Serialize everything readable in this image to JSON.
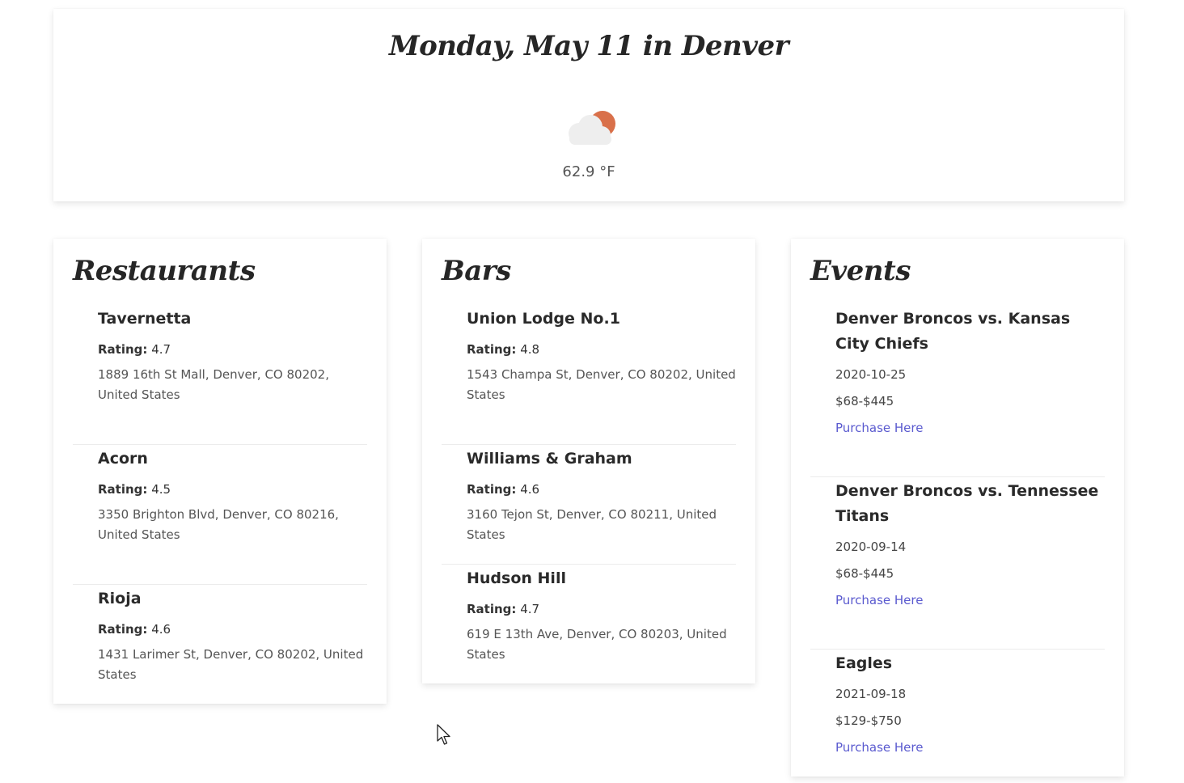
{
  "header": {
    "title": "Monday, May 11 in Denver",
    "weather_icon": "partly-cloudy-icon",
    "temperature": "62.9 °F"
  },
  "colors": {
    "sun": "#d9704a",
    "cloud": "#eeeeee",
    "link": "#5a5acf"
  },
  "restaurants": {
    "title": "Restaurants",
    "rating_label": "Rating:",
    "items": [
      {
        "name": "Tavernetta",
        "rating": "4.7",
        "address": "1889 16th St Mall, Denver, CO 80202, United States"
      },
      {
        "name": "Acorn",
        "rating": "4.5",
        "address": "3350 Brighton Blvd, Denver, CO 80216, United States"
      },
      {
        "name": "Rioja",
        "rating": "4.6",
        "address": "1431 Larimer St, Denver, CO 80202, United States"
      }
    ]
  },
  "bars": {
    "title": "Bars",
    "rating_label": "Rating:",
    "items": [
      {
        "name": "Union Lodge No.1",
        "rating": "4.8",
        "address": "1543 Champa St, Denver, CO 80202, United States"
      },
      {
        "name": "Williams & Graham",
        "rating": "4.6",
        "address": "3160 Tejon St, Denver, CO 80211, United States"
      },
      {
        "name": "Hudson Hill",
        "rating": "4.7",
        "address": "619 E 13th Ave, Denver, CO 80203, United States"
      }
    ]
  },
  "events": {
    "title": "Events",
    "link_label": "Purchase Here",
    "items": [
      {
        "name": "Denver Broncos vs. Kansas City Chiefs",
        "date": "2020-10-25",
        "price": "$68-$445"
      },
      {
        "name": "Denver Broncos vs. Tennessee Titans",
        "date": "2020-09-14",
        "price": "$68-$445"
      },
      {
        "name": "Eagles",
        "date": "2021-09-18",
        "price": "$129-$750"
      }
    ]
  }
}
